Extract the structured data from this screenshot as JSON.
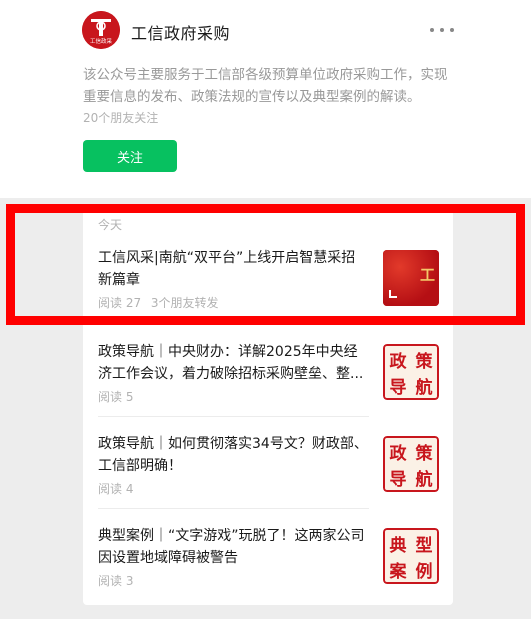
{
  "account": {
    "avatar_icon": "gongxin-zhengcai-logo",
    "logo_text": "工信政采",
    "name": "工信政府采购",
    "more_icon": "more-dots-icon",
    "description": "该公众号主要服务于工信部各级预算单位政府采购工作，实现重要信息的发布、政策法规的宣传以及典型案例的解读。",
    "friends_following": "20个朋友关注",
    "follow_label": "关注"
  },
  "feed": {
    "date_label": "今天",
    "articles": [
      {
        "title": "工信风采|南航“双平台”上线开启智慧采招新篇章",
        "reads": "阅读 27",
        "shares": "3个朋友转发",
        "thumb": {
          "kind": "news",
          "text": "工"
        }
      },
      {
        "title": "政策导航｜中央财办：详解2025年中央经济工作会议，着力破除招标采购壁垒、整...",
        "reads": "阅读 5",
        "thumb": {
          "kind": "tag",
          "chars": [
            "政",
            "策",
            "导",
            "航"
          ]
        }
      },
      {
        "title": "政策导航｜如何贯彻落实34号文？财政部、工信部明确！",
        "reads": "阅读 4",
        "thumb": {
          "kind": "tag",
          "chars": [
            "政",
            "策",
            "导",
            "航"
          ]
        }
      },
      {
        "title": "典型案例｜“文字游戏”玩脱了！这两家公司因设置地域障碍被警告",
        "reads": "阅读 3",
        "thumb": {
          "kind": "tag",
          "chars": [
            "典",
            "型",
            "案",
            "例"
          ]
        }
      }
    ]
  },
  "colors": {
    "accent_green": "#07c160",
    "brand_red": "#c8161d",
    "highlight_red": "#ff0000"
  }
}
